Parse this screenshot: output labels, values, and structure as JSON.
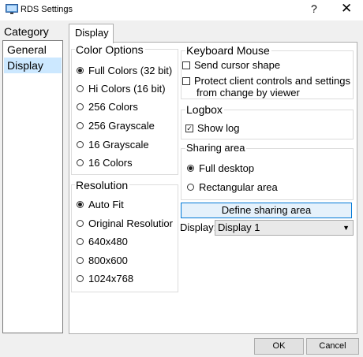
{
  "window": {
    "title": "RDS Settings",
    "help_glyph": "?",
    "close_glyph": "✕"
  },
  "category": {
    "label": "Category",
    "items": [
      {
        "label": "General",
        "selected": false
      },
      {
        "label": "Display",
        "selected": true
      }
    ]
  },
  "tabs": [
    {
      "label": "Display",
      "active": true
    }
  ],
  "color_options": {
    "title": "Color Options",
    "options": [
      {
        "label": "Full Colors (32 bit)",
        "checked": true
      },
      {
        "label": "Hi Colors (16 bit)",
        "checked": false
      },
      {
        "label": "256 Colors",
        "checked": false
      },
      {
        "label": "256 Grayscale",
        "checked": false
      },
      {
        "label": "16 Grayscale",
        "checked": false
      },
      {
        "label": "16 Colors",
        "checked": false
      }
    ]
  },
  "resolution": {
    "title": "Resolution",
    "options": [
      {
        "label": "Auto Fit",
        "checked": true
      },
      {
        "label": "Original Resolutior",
        "checked": false
      },
      {
        "label": "640x480",
        "checked": false
      },
      {
        "label": "800x600",
        "checked": false
      },
      {
        "label": "1024x768",
        "checked": false
      }
    ]
  },
  "keyboard_mouse": {
    "title": "Keyboard Mouse",
    "send_cursor": {
      "label": "Send cursor shape",
      "checked": false
    },
    "protect": {
      "line1": "Protect client controls and settings",
      "line2": "from change by viewer",
      "checked": false
    }
  },
  "logbox": {
    "title": "Logbox",
    "show_log": {
      "label": "Show log",
      "checked": true
    }
  },
  "sharing_area": {
    "title": "Sharing area",
    "options": [
      {
        "label": "Full desktop",
        "checked": true
      },
      {
        "label": "Rectangular area",
        "checked": false
      }
    ],
    "define_button": "Define sharing area"
  },
  "display": {
    "label": "Display:",
    "selected": "Display 1",
    "arrow": "▼"
  },
  "footer": {
    "ok": "OK",
    "cancel": "Cancel"
  },
  "colors": {
    "selection": "#cce8ff",
    "focus_border": "#0078d7",
    "dialog_bg": "#f0f0f0"
  }
}
